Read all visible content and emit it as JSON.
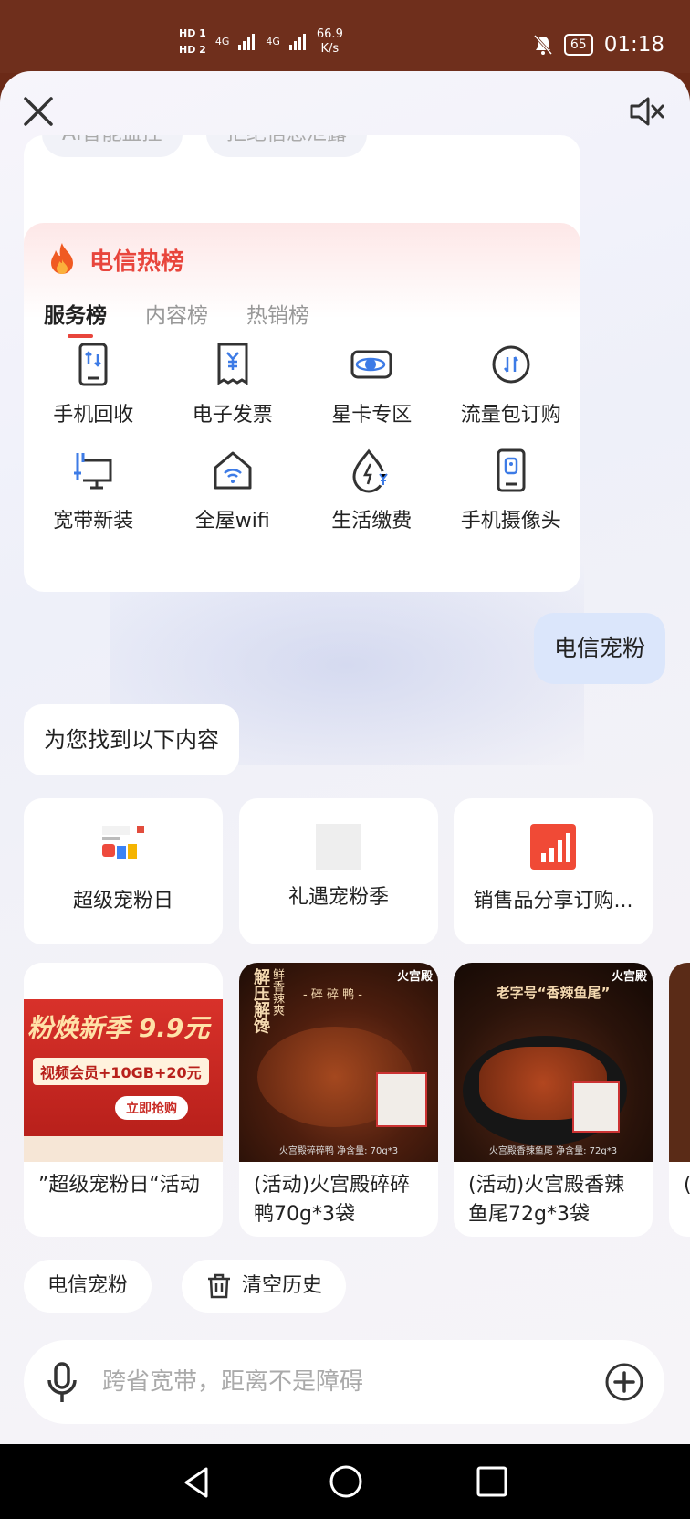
{
  "status_bar": {
    "hd1": "HD 1",
    "hd2": "HD 2",
    "net1": "4G",
    "net2": "4G",
    "speed_value": "66.9",
    "speed_unit": "K/s",
    "battery": "65",
    "time": "01:18"
  },
  "top_card": {
    "chip_1": "AI智能监控",
    "chip_2": "拒绝信息泄露"
  },
  "hot_list": {
    "title": "电信热榜",
    "tabs": [
      "服务榜",
      "内容榜",
      "热销榜"
    ],
    "items": [
      {
        "label": "手机回收",
        "icon": "phone-swap-icon"
      },
      {
        "label": "电子发票",
        "icon": "invoice-icon"
      },
      {
        "label": "星卡专区",
        "icon": "star-card-icon"
      },
      {
        "label": "流量包订购",
        "icon": "data-package-icon"
      },
      {
        "label": "宽带新装",
        "icon": "broadband-icon"
      },
      {
        "label": "全屋wifi",
        "icon": "home-wifi-icon"
      },
      {
        "label": "生活缴费",
        "icon": "life-payment-icon"
      },
      {
        "label": "手机摄像头",
        "icon": "phone-camera-icon"
      }
    ]
  },
  "chat": {
    "user_message": "电信宠粉",
    "bot_message": "为您找到以下内容"
  },
  "link_cards": [
    {
      "title": "超级宠粉日"
    },
    {
      "title": "礼遇宠粉季"
    },
    {
      "title": "销售品分享订购..."
    }
  ],
  "banner_text": {
    "headline": "粉焕新季 9.9元",
    "sub": "视频会员+10GB+20元",
    "cta": "立即抢购"
  },
  "product_cards": [
    {
      "name": "”超级宠粉日“活动"
    },
    {
      "name": "(活动)火宫殿碎碎鸭70g*3袋",
      "img_caption": "火宫殿碎碎鸭 净含量: 70g*3",
      "img_title": "- 碎 碎 鸭 -",
      "img_side": "鲜香辣爽",
      "img_big": "解压解馋",
      "brand": "火宫殿"
    },
    {
      "name": "(活动)火宫殿香辣鱼尾72g*3袋",
      "img_caption": "火宫殿香辣鱼尾 净含量: 72g*3",
      "img_title": "老字号“香辣鱼尾”",
      "brand": "火宫殿"
    },
    {
      "name": "(活"
    }
  ],
  "quick_chips": {
    "history_item": "电信宠粉",
    "clear_history": "清空历史"
  },
  "input": {
    "placeholder": "跨省宽带，距离不是障碍"
  },
  "colors": {
    "accent_red": "#e8453c",
    "user_bubble": "#dbe6fb",
    "status_bar": "#6f2f1c"
  }
}
